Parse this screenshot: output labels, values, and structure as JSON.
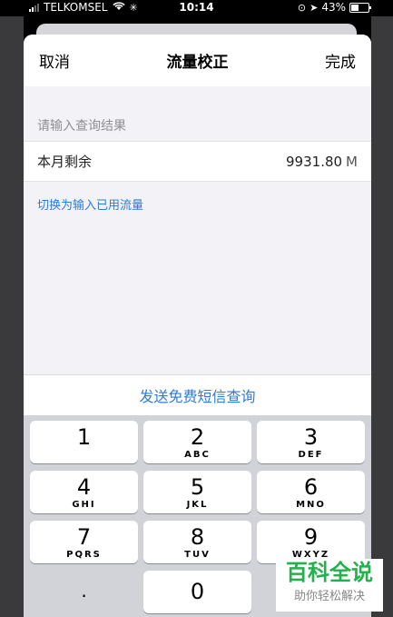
{
  "status_bar": {
    "carrier": "TELKOMSEL",
    "time": "10:14",
    "battery": "43%"
  },
  "nav": {
    "cancel": "取消",
    "title": "流量校正",
    "done": "完成"
  },
  "form": {
    "section_header": "请输入查询结果",
    "row_label": "本月剩余",
    "row_value": "9931.80",
    "row_unit": "M",
    "switch_link": "切换为输入已用流量"
  },
  "sms_button": "发送免费短信查询",
  "keypad": [
    {
      "digit": "1",
      "letters": ""
    },
    {
      "digit": "2",
      "letters": "ABC"
    },
    {
      "digit": "3",
      "letters": "DEF"
    },
    {
      "digit": "4",
      "letters": "GHI"
    },
    {
      "digit": "5",
      "letters": "JKL"
    },
    {
      "digit": "6",
      "letters": "MNO"
    },
    {
      "digit": "7",
      "letters": "PQRS"
    },
    {
      "digit": "8",
      "letters": "TUV"
    },
    {
      "digit": "9",
      "letters": "WXYZ"
    },
    {
      "digit": ".",
      "letters": ""
    },
    {
      "digit": "0",
      "letters": ""
    }
  ],
  "watermark": {
    "title": "百科全说",
    "subtitle": "助你轻松解决"
  },
  "colors": {
    "accent": "#2f7bd8",
    "watermark_green": "#23b14d"
  }
}
